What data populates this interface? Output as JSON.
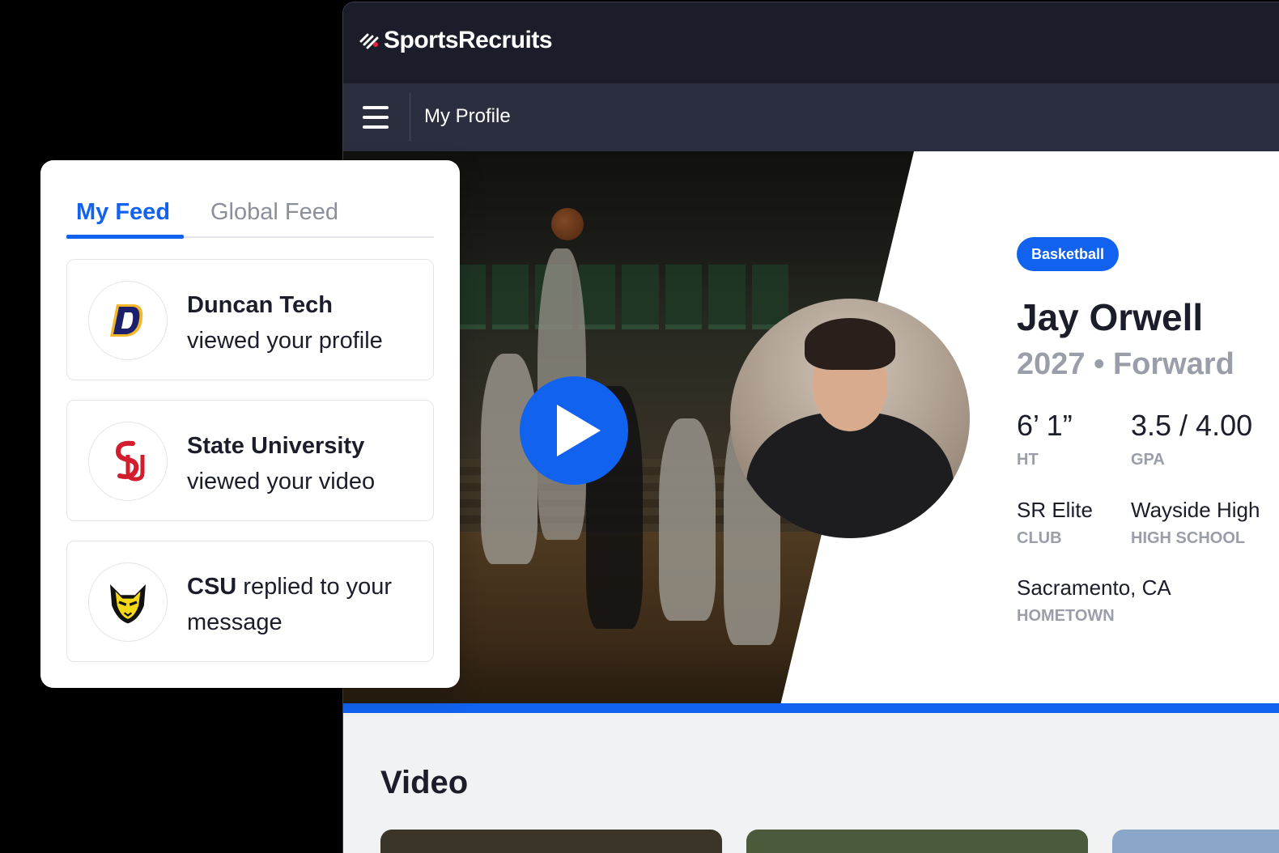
{
  "app": {
    "brand": "SportsRecruits",
    "page_title": "My Profile"
  },
  "profile": {
    "sport": "Basketball",
    "name": "Jay Orwell",
    "subtitle": "2027 • Forward",
    "stats": [
      {
        "value": "6’ 1”",
        "label": "HT"
      },
      {
        "value": "3.5 / 4.00",
        "label": "GPA"
      },
      {
        "value": "SR Elite",
        "label": "CLUB"
      },
      {
        "value": "Wayside High",
        "label": "HIGH SCHOOL"
      },
      {
        "value": "Sacramento, CA",
        "label": "HOMETOWN"
      }
    ]
  },
  "content": {
    "section_title": "Video"
  },
  "feed": {
    "tabs": [
      "My Feed",
      "Global Feed"
    ],
    "active_tab": "My Feed",
    "items": [
      {
        "org": "Duncan Tech",
        "action": "viewed your profile",
        "logo": "duncan-tech-logo"
      },
      {
        "org": "State University",
        "action": "viewed your video",
        "logo": "state-university-logo"
      },
      {
        "org": "CSU",
        "action": "replied to your message",
        "logo": "csu-logo"
      }
    ]
  },
  "colors": {
    "accent": "#1262f0",
    "dark": "#1b1d2a",
    "muted": "#9a9ea8"
  }
}
